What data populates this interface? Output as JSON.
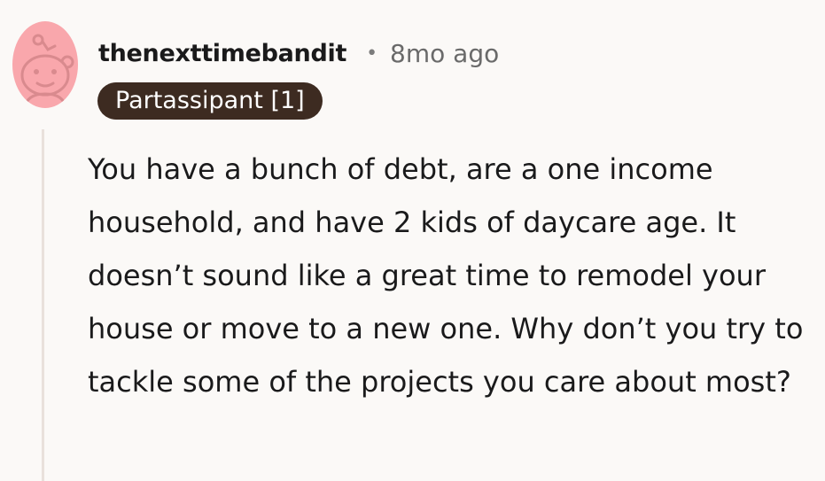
{
  "comment": {
    "author": "thenexttimebandit",
    "separator": "•",
    "timestamp": "8mo ago",
    "flair": "Partassipant [1]",
    "body": "You have a bunch of debt, are a one income household, and have 2 kids of daycare age. It doesn’t sound like a great time to remodel your house or move to a new one. Why don’t you try to tackle some of the projects you care about most?"
  },
  "colors": {
    "background": "#fbf9f7",
    "avatar_bg": "#f9a7ac",
    "avatar_glyph": "#d98a8e",
    "flair_bg": "#3d2b21",
    "thread_line": "#e9e1dc"
  },
  "icons": {
    "avatar": "snoo-avatar-icon"
  }
}
